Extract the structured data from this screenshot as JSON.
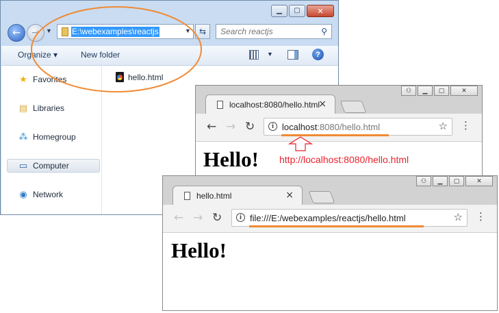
{
  "explorer": {
    "window_buttons": [
      "minimize",
      "maximize",
      "close"
    ],
    "address": "E:\\webexamples\\reactjs",
    "search_placeholder": "Search reactjs",
    "toolbar": {
      "organize": "Organize ▾",
      "new_folder": "New folder"
    },
    "nav_items": [
      {
        "label": "Favorites",
        "icon": "star-icon"
      },
      {
        "label": "Libraries",
        "icon": "libraries-icon"
      },
      {
        "label": "Homegroup",
        "icon": "homegroup-icon"
      },
      {
        "label": "Computer",
        "icon": "computer-icon",
        "selected": true
      },
      {
        "label": "Network",
        "icon": "network-icon"
      }
    ],
    "files": [
      {
        "name": "hello.html",
        "icon": "chrome-html-file-icon"
      }
    ]
  },
  "browser_top": {
    "tab_title": "localhost:8080/hello.html",
    "url_host": "localhost",
    "url_rest": ":8080/hello.html",
    "page_heading": "Hello!"
  },
  "browser_bottom": {
    "tab_title": "hello.html",
    "url": "file:///E:/webexamples/reactjs/hello.html",
    "page_heading": "Hello!"
  },
  "annotations": {
    "url_label": "http://localhost:8080/hello.html",
    "highlight_color": "#f08a34",
    "label_color": "#e8222c"
  }
}
